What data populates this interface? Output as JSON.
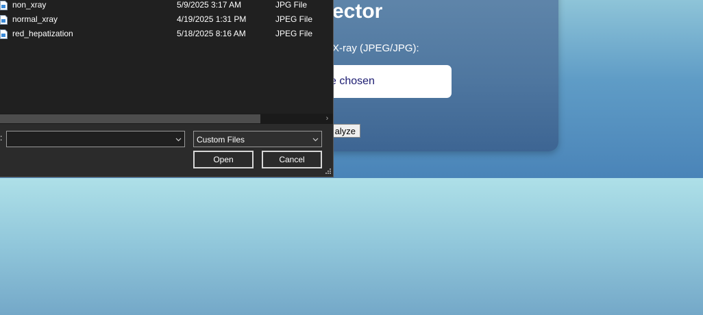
{
  "page": {
    "card_title": "ector",
    "upload_label": "X-ray (JPEG/JPG):",
    "file_status": "e chosen",
    "analyze_button": "alyze"
  },
  "dialog": {
    "files": [
      {
        "name": "non_xray",
        "date": "5/9/2025 3:17 AM",
        "type": "JPG File",
        "icon": "image-file-icon"
      },
      {
        "name": "normal_xray",
        "date": "4/19/2025 1:31 PM",
        "type": "JPEG File",
        "icon": "image-file-icon"
      },
      {
        "name": "red_hepatization",
        "date": "5/18/2025 8:16 AM",
        "type": "JPEG File",
        "icon": "image-file-icon"
      }
    ],
    "filename_label_stub": ":",
    "filename_value": "",
    "filter_selected": "Custom Files",
    "open_label": "Open",
    "cancel_label": "Cancel"
  },
  "colors": {
    "dialog_bg": "#2b2b2b",
    "file_list_bg": "#202020",
    "card_bg": "#4f77a0",
    "page_bg_top": "#5f9cc6",
    "page_bg_bottom": "#90c6da"
  }
}
